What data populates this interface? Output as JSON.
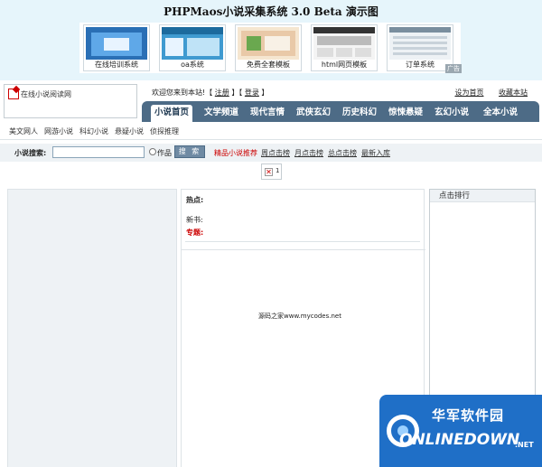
{
  "page_title": "PHPMaos小说采集系统 3.0 Beta 演示图",
  "ads": [
    {
      "caption": "在线培训系统",
      "icon": "training-thumb"
    },
    {
      "caption": "oa系统",
      "icon": "oa-thumb"
    },
    {
      "caption": "免费全套模板",
      "icon": "template-thumb"
    },
    {
      "caption": "html网页模板",
      "icon": "html-template-thumb"
    },
    {
      "caption": "订单系统",
      "icon": "order-thumb"
    }
  ],
  "ad_tag": "广告",
  "logo_text": "在线小说阅读网",
  "welcome": {
    "prefix": "欢迎您来到本站!【",
    "register": "注册",
    "mid": "】【",
    "login": "登录",
    "suffix": "】"
  },
  "top_links": [
    "设为首页",
    "收藏本站"
  ],
  "nav": [
    "小说首页",
    "文学频道",
    "现代言情",
    "武侠玄幻",
    "历史科幻",
    "惊悚悬疑",
    "玄幻小说",
    "全本小说"
  ],
  "subnav": [
    "美文网人",
    "网游小说",
    "科幻小说",
    "悬疑小说",
    "侦探推理"
  ],
  "search": {
    "label": "小说搜索:",
    "value": "",
    "radio_label": "作品",
    "button": "搜 索"
  },
  "quick_links": [
    {
      "label": "精品小说推荐",
      "red": true
    },
    {
      "label": "周点击榜",
      "red": false
    },
    {
      "label": "月点击榜",
      "red": false
    },
    {
      "label": "总点击榜",
      "red": false
    },
    {
      "label": "最新入库",
      "red": false
    }
  ],
  "broken_image_number": "1",
  "middle": {
    "hot": "热点:",
    "new": "新书:",
    "special": "专题:",
    "footer": "源码之家www.mycodes.net"
  },
  "right_header": "点击排行",
  "watermark": {
    "cn": "华军软件园",
    "en": "ONLINEDOWN",
    "net": ".NET"
  },
  "colors": {
    "nav_bg": "#4d6b86",
    "page_bg": "#e6f5fb",
    "accent_red": "#cc0000",
    "watermark_blue": "#1f6fc7"
  }
}
